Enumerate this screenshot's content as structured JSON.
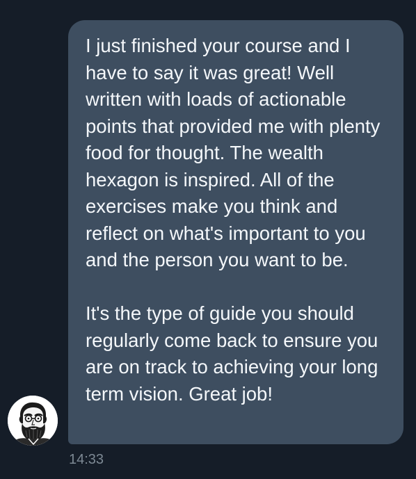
{
  "message": {
    "paragraphs": [
      "I just finished your course and I have to say it was great! Well written with loads of actionable points that provided me with plenty food for thought. The wealth hexagon is inspired. All of the exercises make you think and reflect on what's important to you and the person you want to be.",
      "It's the type of guide you should regularly come back to ensure you are on track to achieving your long term vision. Great job!"
    ],
    "timestamp": "14:33"
  },
  "avatar": {
    "icon": "bearded-man-sketch-icon"
  },
  "colors": {
    "background": "#151d28",
    "bubble": "#3e4e60",
    "text": "#f4f7fa",
    "timestamp": "#7d8994"
  }
}
